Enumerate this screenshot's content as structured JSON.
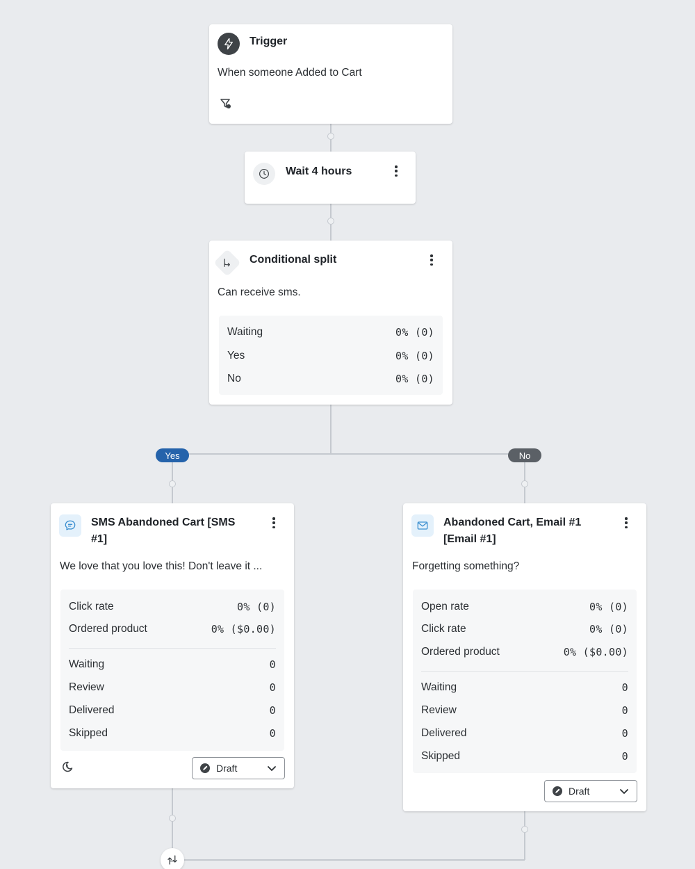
{
  "trigger": {
    "title": "Trigger",
    "description": "When someone Added to Cart"
  },
  "wait": {
    "title": "Wait 4 hours"
  },
  "split": {
    "title": "Conditional split",
    "description": "Can receive sms.",
    "stats": [
      {
        "label": "Waiting",
        "value": "0% (0)"
      },
      {
        "label": "Yes",
        "value": "0% (0)"
      },
      {
        "label": "No",
        "value": "0% (0)"
      }
    ]
  },
  "branches": {
    "yes_label": "Yes",
    "no_label": "No"
  },
  "sms": {
    "title_line1": "SMS Abandoned Cart [SMS",
    "title_line2": "#1]",
    "preview": "We love that you love this! Don't leave it ...",
    "metrics": [
      {
        "label": "Click rate",
        "value": "0% (0)"
      },
      {
        "label": "Ordered product",
        "value": "0% ($0.00)"
      }
    ],
    "counts": [
      {
        "label": "Waiting",
        "value": "0"
      },
      {
        "label": "Review",
        "value": "0"
      },
      {
        "label": "Delivered",
        "value": "0"
      },
      {
        "label": "Skipped",
        "value": "0"
      }
    ],
    "status": "Draft"
  },
  "email": {
    "title_line1": "Abandoned Cart, Email #1",
    "title_line2": "[Email #1]",
    "preview": "Forgetting something?",
    "metrics": [
      {
        "label": "Open rate",
        "value": "0% (0)"
      },
      {
        "label": "Click rate",
        "value": "0% (0)"
      },
      {
        "label": "Ordered product",
        "value": "0% ($0.00)"
      }
    ],
    "counts": [
      {
        "label": "Waiting",
        "value": "0"
      },
      {
        "label": "Review",
        "value": "0"
      },
      {
        "label": "Delivered",
        "value": "0"
      },
      {
        "label": "Skipped",
        "value": "0"
      }
    ],
    "status": "Draft"
  },
  "colors": {
    "yes_pill": "#2563ab",
    "no_pill": "#5b6066",
    "sms_icon_bg": "#e4f1fb",
    "sms_icon": "#3b8fd0"
  }
}
